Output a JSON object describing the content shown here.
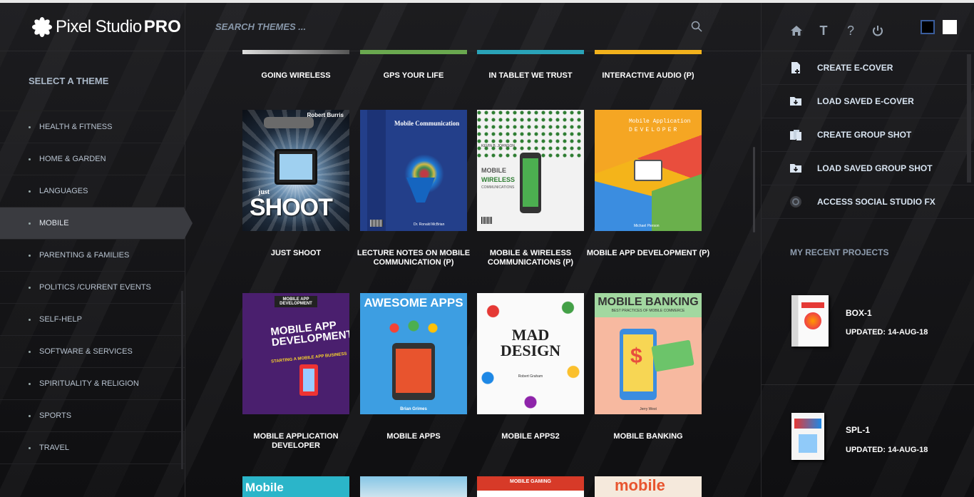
{
  "app": {
    "logo_text": "Pixel Studio",
    "logo_pro": "PRO"
  },
  "search": {
    "placeholder": "SEARCH THEMES ..."
  },
  "sidebar": {
    "heading": "SELECT A THEME",
    "categories": [
      "HEALTH & FITNESS",
      "HOME & GARDEN",
      "LANGUAGES",
      "MOBILE",
      "PARENTING & FAMILIES",
      "POLITICS /CURRENT EVENTS",
      "SELF-HELP",
      "SOFTWARE & SERVICES",
      "SPIRITUALITY & RELIGION",
      "SPORTS",
      "TRAVEL"
    ],
    "active": "MOBILE"
  },
  "themes": {
    "row0": [
      "GOING WIRELESS",
      "GPS YOUR LIFE",
      "IN TABLET WE TRUST",
      "INTERACTIVE AUDIO (P)"
    ],
    "row1": [
      "JUST SHOOT",
      "LECTURE NOTES ON MOBILE COMMUNICATION (P)",
      "MOBILE & WIRELESS COMMUNICATIONS (P)",
      "MOBILE APP DEVELOPMENT (P)"
    ],
    "row2": [
      "MOBILE APPLICATION DEVELOPER",
      "MOBILE APPS",
      "MOBILE APPS2",
      "MOBILE BANKING"
    ],
    "covers": {
      "just_shoot_author": "Robert Burris",
      "just_shoot_small": "just",
      "just_shoot_title": "SHOOT",
      "lecture_title": "Mobile Communication",
      "lecture_author": "Dr. Ronald McBrian",
      "wireless_a": "MOBILE",
      "wireless_b": "WIRELESS",
      "wireless_c": "COMMUNICATIONS",
      "wireless_author": "KEVIN B. JOHNSON",
      "appdev_title": "Mobile Application",
      "appdev_sub": "DEVELOPER",
      "appdev_author": "Michael Pierson",
      "appdev2_top": "MOBILE APP DEVELOPMENT",
      "appdev2_title": "MOBILE APP DEVELOPMENT",
      "appdev2_sub": "STARTING A MOBILE APP BUSINESS",
      "apps_title": "AWESOME APPS",
      "apps_author": "Brian Grimes",
      "mad_title": "MAD DESIGN",
      "mad_author": "Robert Graham",
      "banking_title": "MOBILE BANKING",
      "banking_sub": "BEST PRACTICES OF MOBILE COMMERCE",
      "banking_author": "Jerry West",
      "computing_title": "Mobile Computing",
      "gaming_title": "MOBILE GAMING",
      "mobile_word": "mobile"
    }
  },
  "right_panel": {
    "toolbar": {
      "text_icon_glyph": "T",
      "help_icon_glyph": "?"
    },
    "menu": [
      "CREATE E-COVER",
      "LOAD SAVED E-COVER",
      "CREATE GROUP SHOT",
      "LOAD SAVED GROUP SHOT",
      "ACCESS SOCIAL STUDIO FX"
    ],
    "recent_heading": "MY RECENT PROJECTS",
    "projects": [
      {
        "name": "BOX-1",
        "updated": "UPDATED: 14-AUG-18"
      },
      {
        "name": "SPL-1",
        "updated": "UPDATED: 14-AUG-18"
      }
    ]
  }
}
